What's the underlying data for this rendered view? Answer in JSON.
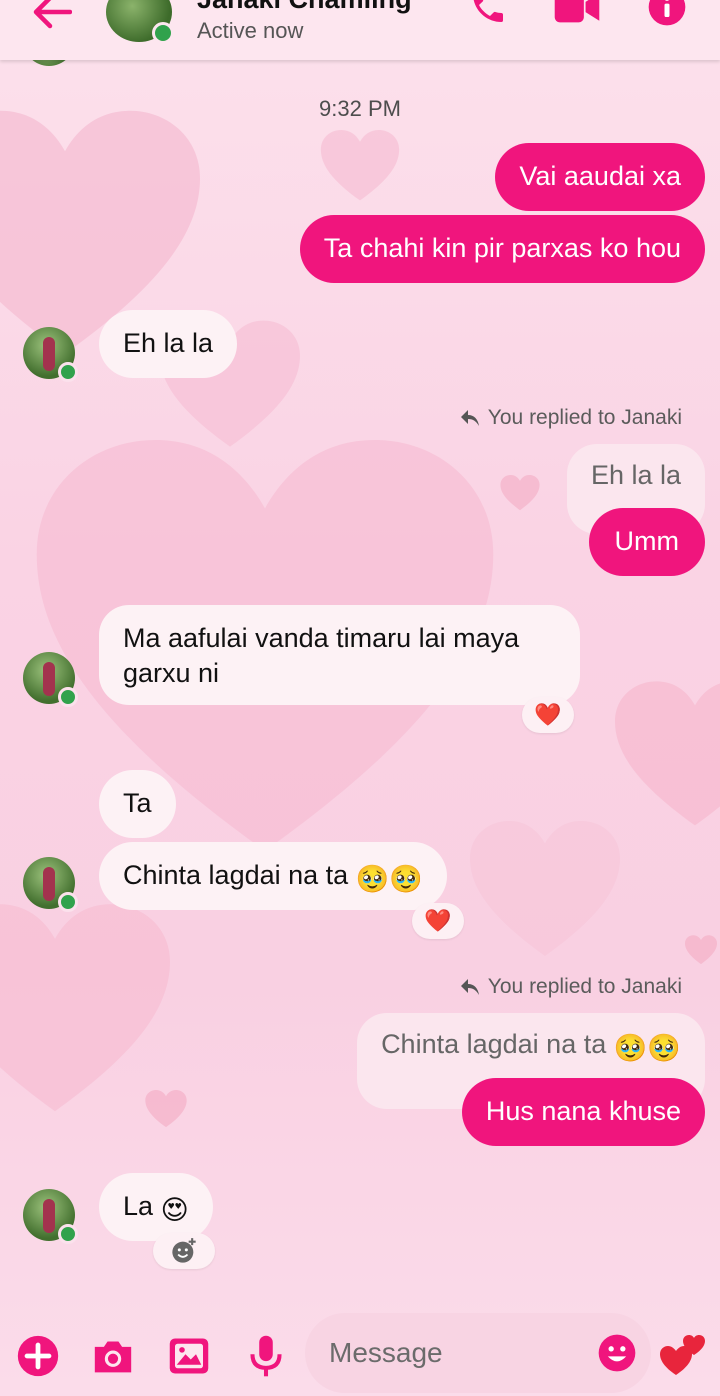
{
  "header": {
    "contact_name": "Janaki Chamling",
    "status": "Active now",
    "icons": [
      "back-arrow-icon",
      "phone-icon",
      "video-icon",
      "info-icon"
    ]
  },
  "timestamp": "9:32 PM",
  "messages": {
    "m1": "Vai aaudai xa",
    "m2": "Ta chahi kin pir parxas ko hou",
    "m3": "Eh la la",
    "reply1_label": "You replied to Janaki",
    "reply1_quote": "Eh la la",
    "m4": "Umm",
    "m5_line1": "Ma aafulai vanda timaru lai maya",
    "m5_line2": "garxu ni",
    "m5_reaction": "❤️",
    "m6": "Ta",
    "m7": "Chinta lagdai na ta",
    "m7_emoji": "🥹🥹",
    "m7_reaction": "❤️",
    "reply2_label": "You replied to Janaki",
    "reply2_quote": "Chinta lagdai na ta",
    "reply2_quote_emoji": "🥹🥹",
    "m8": "Hus nana khuse",
    "m9": "La",
    "m9_emoji": "😍"
  },
  "composer": {
    "placeholder": "Message",
    "icons": [
      "plus-icon",
      "camera-icon",
      "gallery-icon",
      "mic-icon",
      "emoji-icon",
      "hearts-icon"
    ]
  },
  "colors": {
    "accent": "#f0157d",
    "online": "#31a24c",
    "incoming_bubble": "#fdf2f5"
  }
}
